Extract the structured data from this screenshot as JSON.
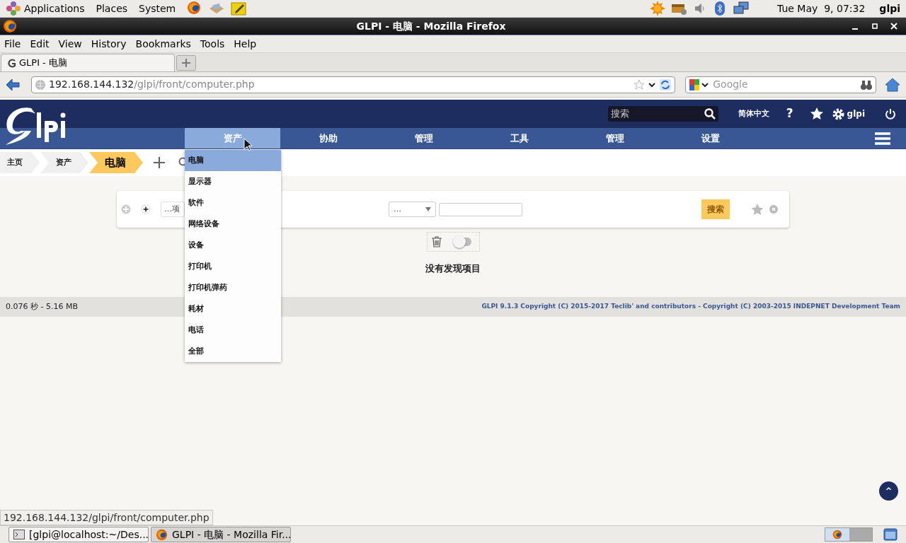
{
  "desktop_panel": {
    "menus": [
      "Applications",
      "Places",
      "System"
    ],
    "clock": "Tue May  9, 07:32",
    "user": "glpi"
  },
  "window": {
    "title": "GLPI - 电脑 - Mozilla Firefox"
  },
  "menubar": [
    {
      "label": "File"
    },
    {
      "label": "Edit"
    },
    {
      "label": "View"
    },
    {
      "label": "History"
    },
    {
      "label": "Bookmarks"
    },
    {
      "label": "Tools"
    },
    {
      "label": "Help"
    }
  ],
  "tabs": [
    {
      "label": "GLPI - 电脑",
      "selected": true
    }
  ],
  "address_bar": {
    "host": "192.168.144.132",
    "path": "/glpi/front/computer.php"
  },
  "web_search": {
    "placeholder": "Google"
  },
  "glpi_header": {
    "search_placeholder": "搜索",
    "language": "简体中文",
    "help": "?",
    "user": "glpi"
  },
  "main_menu": [
    {
      "label": "资产",
      "selected": true
    },
    {
      "label": "协助",
      "selected": false
    },
    {
      "label": "管理",
      "selected": false
    },
    {
      "label": "工具",
      "selected": false
    },
    {
      "label": "管理",
      "selected": false
    },
    {
      "label": "设置",
      "selected": false
    }
  ],
  "submenu": [
    {
      "label": "电脑",
      "selected": true
    },
    {
      "label": "显示器",
      "selected": false
    },
    {
      "label": "软件",
      "selected": false
    },
    {
      "label": "网络设备",
      "selected": false
    },
    {
      "label": "设备",
      "selected": false
    },
    {
      "label": "打印机",
      "selected": false
    },
    {
      "label": "打印机弹药",
      "selected": false
    },
    {
      "label": "耗材",
      "selected": false
    },
    {
      "label": "电话",
      "selected": false
    },
    {
      "label": "全部",
      "selected": false
    }
  ],
  "breadcrumb": [
    {
      "label": "主页",
      "current": false
    },
    {
      "label": "资产",
      "current": false
    },
    {
      "label": "电脑",
      "current": true
    }
  ],
  "search_form": {
    "field_select": "…项",
    "operator_select": "…",
    "search_button": "搜索"
  },
  "trash_toggle": {
    "on": false
  },
  "empty_message": "没有发现项目",
  "footer": {
    "stats": "0.076 秒 - 5.16 MB",
    "copyright": "GLPI 9.1.3 Copyright (C) 2015-2017 Teclib' and contributors - Copyright (C) 2003-2015 INDEPNET Development Team"
  },
  "back_to_top": "^",
  "status_url": "192.168.144.132/glpi/front/computer.php",
  "taskbar": [
    {
      "kind": "terminal",
      "label": "[glpi@localhost:~/Des...",
      "selected": false
    },
    {
      "kind": "browser",
      "label": "GLPI - 电脑 - Mozilla Fir...",
      "selected": true
    }
  ]
}
